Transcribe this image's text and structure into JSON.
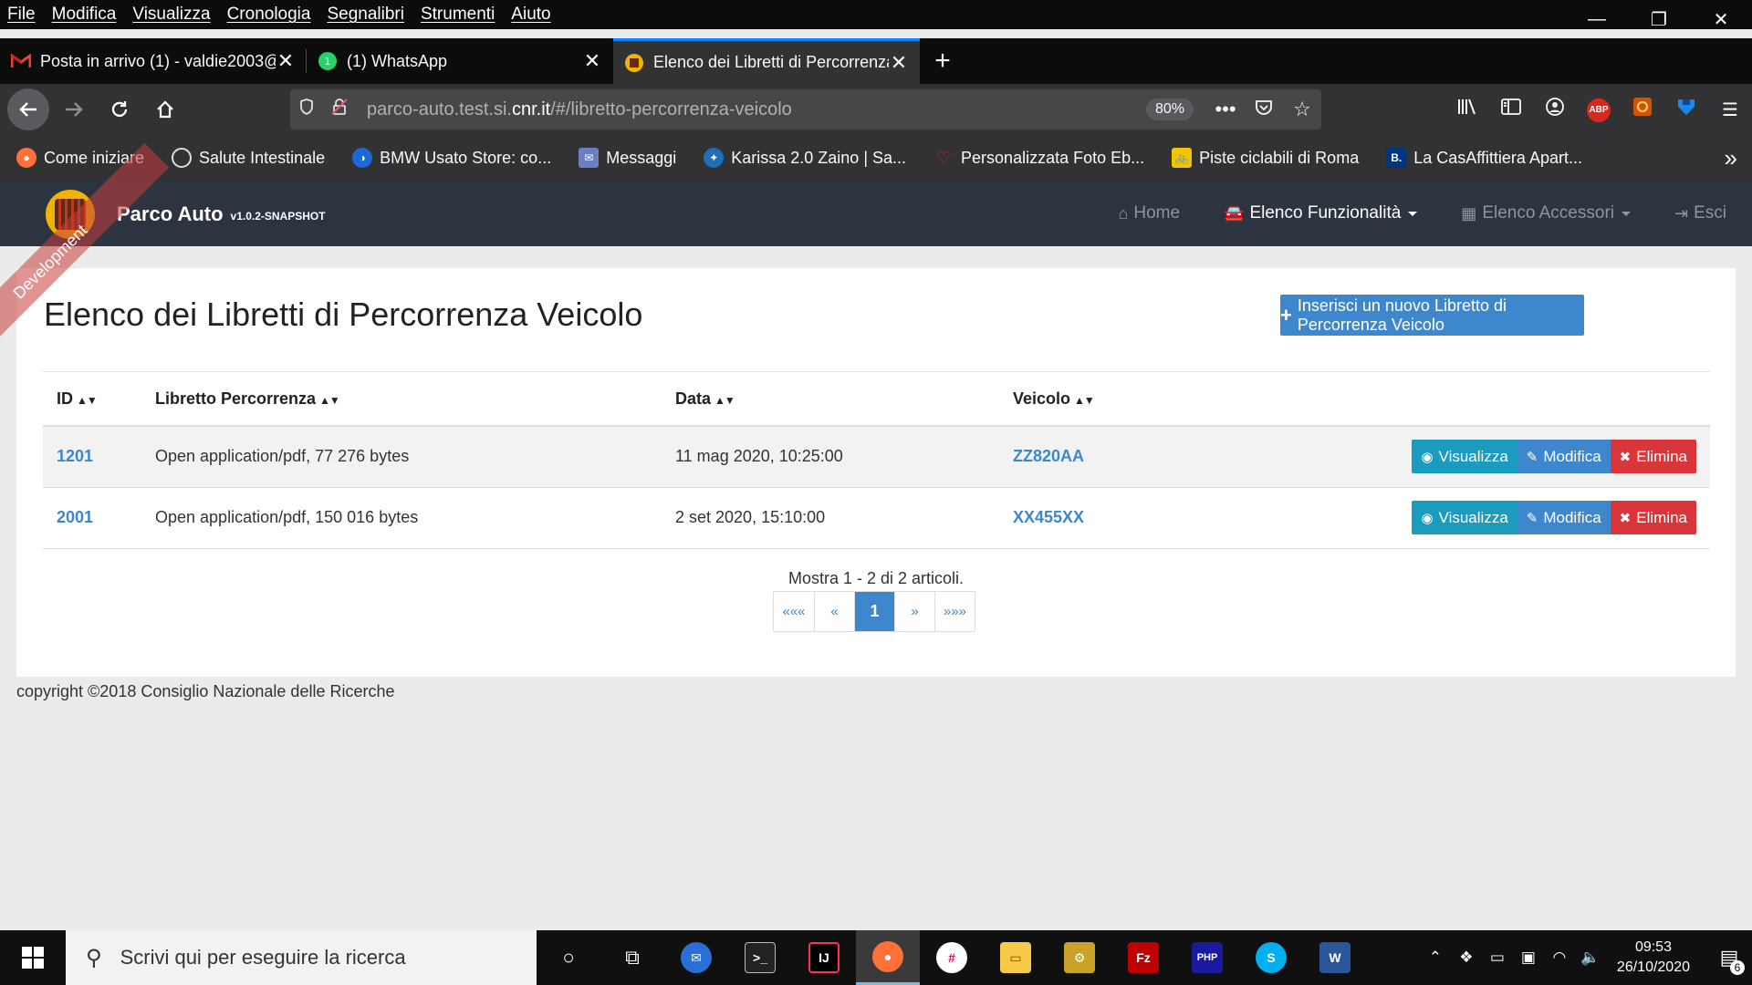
{
  "browser": {
    "menu": [
      "File",
      "Modifica",
      "Visualizza",
      "Cronologia",
      "Segnalibri",
      "Strumenti",
      "Aiuto"
    ],
    "window_controls": {
      "minimize": "—",
      "restore": "❐",
      "close": "✕"
    },
    "tabs": [
      {
        "label": "Posta in arrivo (1) - valdie2003@",
        "icon": "gmail-icon",
        "active": false
      },
      {
        "label": "(1) WhatsApp",
        "icon": "whatsapp-icon",
        "active": false
      },
      {
        "label": "Elenco dei Libretti di Percorrenza",
        "icon": "parco-auto-icon",
        "active": true
      }
    ],
    "url_prefix": "parco-auto.test.si.",
    "url_host": "cnr.it",
    "url_path": "/#/libretto-percorrenza-veicolo",
    "zoom": "80%",
    "bookmarks": [
      {
        "label": "Come iniziare",
        "icon": "firefox-icon",
        "color": "#ff7139"
      },
      {
        "label": "Salute Intestinale",
        "icon": "globe-icon",
        "color": "#555555"
      },
      {
        "label": "BMW Usato Store: co...",
        "icon": "bmw-icon",
        "color": "#1c69d4"
      },
      {
        "label": "Messaggi",
        "icon": "messages-icon",
        "color": "#6b7fbf"
      },
      {
        "label": "Karissa 2.0 Zaino | Sa...",
        "icon": "karissa-icon",
        "color": "#1e6fb8"
      },
      {
        "label": "Personalizzata Foto Eb...",
        "icon": "heart-icon",
        "color": "#c2185b"
      },
      {
        "label": "Piste ciclabili di Roma",
        "icon": "bike-icon",
        "color": "#f3c400"
      },
      {
        "label": "La CasAffittiera Apart...",
        "icon": "booking-icon",
        "color": "#003580"
      }
    ]
  },
  "app": {
    "brand": "Parco Auto",
    "version": "v1.0.2-SNAPSHOT",
    "ribbon": "Development",
    "nav": {
      "home": "Home",
      "funzionalita": "Elenco Funzionalità",
      "accessori": "Elenco Accessori",
      "esci": "Esci"
    },
    "page_title": "Elenco dei Libretti di Percorrenza Veicolo",
    "new_button": "Inserisci un nuovo Libretto di Percorrenza Veicolo",
    "columns": [
      "ID",
      "Libretto Percorrenza",
      "Data",
      "Veicolo"
    ],
    "rows": [
      {
        "id": "1201",
        "libretto": "Open application/pdf, 77 276 bytes",
        "data": "11 mag 2020, 10:25:00",
        "veicolo": "ZZ820AA"
      },
      {
        "id": "2001",
        "libretto": "Open application/pdf, 150 016 bytes",
        "data": "2 set 2020, 15:10:00",
        "veicolo": "XX455XX"
      }
    ],
    "actions": {
      "view": "Visualizza",
      "edit": "Modifica",
      "delete": "Elimina"
    },
    "summary": "Mostra 1 - 2 di 2 articoli.",
    "pager": {
      "first": "«««",
      "prev": "«",
      "current": "1",
      "next": "»",
      "last": "»»»"
    },
    "footer": "copyright ©2018 Consiglio Nazionale delle Ricerche"
  },
  "taskbar": {
    "search_placeholder": "Scrivi qui per eseguire la ricerca",
    "time": "09:53",
    "date": "26/10/2020",
    "notifications": "6"
  }
}
